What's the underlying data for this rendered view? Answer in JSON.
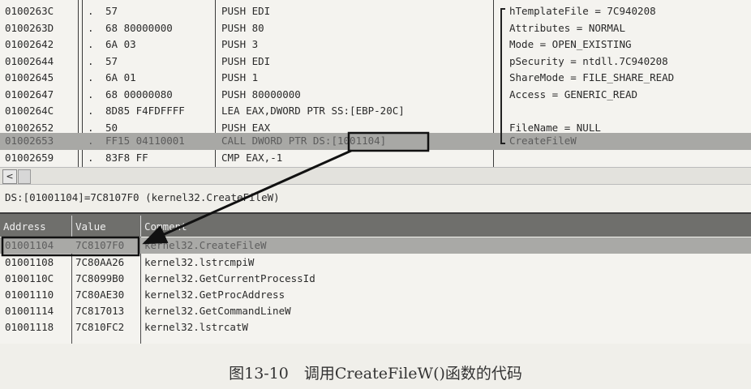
{
  "disassembly": {
    "rows": [
      {
        "address": "0100263C",
        "marker": ".",
        "hex": "57",
        "instruction": "PUSH EDI",
        "comment": "hTemplateFile = 7C940208"
      },
      {
        "address": "0100263D",
        "marker": ".",
        "hex": "68 80000000",
        "instruction": "PUSH 80",
        "comment": "Attributes = NORMAL"
      },
      {
        "address": "01002642",
        "marker": ".",
        "hex": "6A 03",
        "instruction": "PUSH 3",
        "comment": "Mode = OPEN_EXISTING"
      },
      {
        "address": "01002644",
        "marker": ".",
        "hex": "57",
        "instruction": "PUSH EDI",
        "comment": "pSecurity = ntdll.7C940208"
      },
      {
        "address": "01002645",
        "marker": ".",
        "hex": "6A 01",
        "instruction": "PUSH 1",
        "comment": "ShareMode = FILE_SHARE_READ"
      },
      {
        "address": "01002647",
        "marker": ".",
        "hex": "68 00000080",
        "instruction": "PUSH 80000000",
        "comment": "Access = GENERIC_READ"
      },
      {
        "address": "0100264C",
        "marker": ".",
        "hex": "8D85 F4FDFFFF",
        "instruction": "LEA EAX,DWORD PTR SS:[EBP-20C]",
        "comment": ""
      },
      {
        "address": "01002652",
        "marker": ".",
        "hex": "50",
        "instruction": "PUSH EAX",
        "comment": "FileName = NULL"
      },
      {
        "address": "01002653",
        "marker": ".",
        "hex": "FF15 04110001",
        "instruction": "CALL DWORD PTR DS:[1001104]",
        "comment": "CreateFileW"
      },
      {
        "address": "01002659",
        "marker": ".",
        "hex": "83F8 FF",
        "instruction": "CMP EAX,-1",
        "comment": ""
      }
    ],
    "selected_index": 8
  },
  "scrollbar": {
    "left_arrow": "<"
  },
  "info_line": "DS:[01001104]=7C8107F0 (kernel32.CreateFileW)",
  "dump": {
    "columns": [
      "Address",
      "Value",
      "Comment"
    ],
    "rows": [
      {
        "address": "01001104",
        "value": "7C8107F0",
        "comment": "kernel32.CreateFileW"
      },
      {
        "address": "01001108",
        "value": "7C80AA26",
        "comment": "kernel32.lstrcmpiW"
      },
      {
        "address": "0100110C",
        "value": "7C8099B0",
        "comment": "kernel32.GetCurrentProcessId"
      },
      {
        "address": "01001110",
        "value": "7C80AE30",
        "comment": "kernel32.GetProcAddress"
      },
      {
        "address": "01001114",
        "value": "7C817013",
        "comment": "kernel32.GetCommandLineW"
      },
      {
        "address": "01001118",
        "value": "7C810FC2",
        "comment": "kernel32.lstrcatW"
      }
    ],
    "selected_index": 0
  },
  "caption": "图13-10　调用CreateFileW()函数的代码",
  "colors": {
    "selection": "#a8a8a5",
    "header": "#6f6f6c",
    "annotation": "#111111"
  }
}
